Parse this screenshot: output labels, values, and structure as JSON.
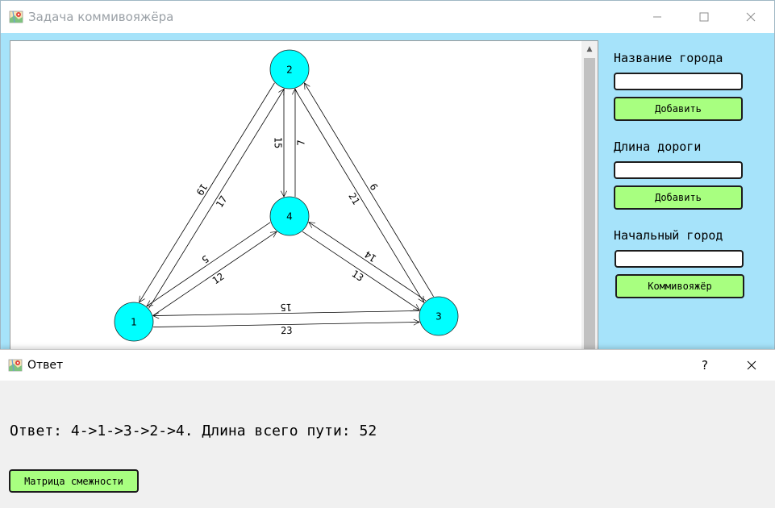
{
  "main_window": {
    "title": "Задача коммивояжёра",
    "controls": {
      "minimize": "—",
      "maximize": "☐",
      "close": "✕"
    }
  },
  "graph": {
    "nodes": [
      {
        "id": "2",
        "label": "2"
      },
      {
        "id": "4",
        "label": "4"
      },
      {
        "id": "1",
        "label": "1"
      },
      {
        "id": "3",
        "label": "3"
      }
    ],
    "edge_weights": [
      {
        "from": "1",
        "to": "2",
        "label": "17"
      },
      {
        "from": "2",
        "to": "1",
        "label": "19"
      },
      {
        "from": "4",
        "to": "2",
        "label": "7"
      },
      {
        "from": "2",
        "to": "4",
        "label": "15"
      },
      {
        "from": "2",
        "to": "3",
        "label": "21"
      },
      {
        "from": "3",
        "to": "2",
        "label": "9"
      },
      {
        "from": "1",
        "to": "4",
        "label": "12"
      },
      {
        "from": "4",
        "to": "1",
        "label": "5"
      },
      {
        "from": "4",
        "to": "3",
        "label": "13"
      },
      {
        "from": "3",
        "to": "4",
        "label": "14"
      },
      {
        "from": "1",
        "to": "3",
        "label": "23"
      },
      {
        "from": "3",
        "to": "1",
        "label": "15"
      }
    ],
    "node_color": "#00ffff",
    "scroll_up_arrow": "▲"
  },
  "sidebar": {
    "city_name_label": "Название города",
    "city_add_button": "Добавить",
    "road_length_label": "Длина дороги",
    "road_add_button": "Добавить",
    "start_city_label": "Начальный город",
    "salesman_button": "Коммивояжёр",
    "button_color": "#a8ff80",
    "background_color": "#a6e3fa"
  },
  "answer_dialog": {
    "title": "Ответ",
    "help": "?",
    "close": "✕",
    "answer": "Ответ: 4->1->3->2->4. Длина всего пути: 52",
    "matrix_button": "Матрица смежности"
  }
}
